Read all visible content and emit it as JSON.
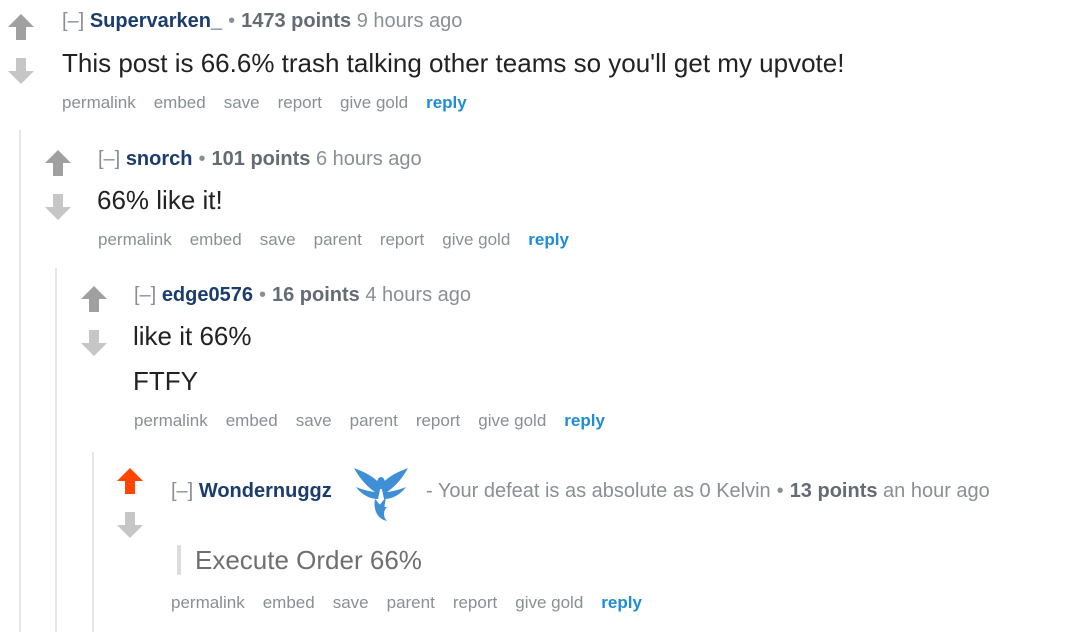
{
  "comments": [
    {
      "toggle": "[–]",
      "author": "Supervarken_",
      "score": "1473 points",
      "time": "9 hours ago",
      "body": [
        "This post is 66.6% trash talking other teams so you'll get my upvote!"
      ],
      "buttons": [
        "permalink",
        "embed",
        "save",
        "report",
        "give gold",
        "reply"
      ],
      "upvoted": false
    },
    {
      "toggle": "[–]",
      "author": "snorch",
      "score": "101 points",
      "time": "6 hours ago",
      "body": [
        "66% like it!"
      ],
      "buttons": [
        "permalink",
        "embed",
        "save",
        "parent",
        "report",
        "give gold",
        "reply"
      ],
      "upvoted": false
    },
    {
      "toggle": "[–]",
      "author": "edge0576",
      "score": "16 points",
      "time": "4 hours ago",
      "body": [
        "like it 66%",
        "FTFY"
      ],
      "buttons": [
        "permalink",
        "embed",
        "save",
        "parent",
        "report",
        "give gold",
        "reply"
      ],
      "upvoted": false
    },
    {
      "toggle": "[–]",
      "author": "Wondernuggz",
      "flair_text": "- Your defeat is as absolute as 0 Kelvin",
      "flair_icon": "team-mystic-bird-icon",
      "score": "13 points",
      "time": "an hour ago",
      "quote": "Execute Order 66%",
      "buttons": [
        "permalink",
        "embed",
        "save",
        "parent",
        "report",
        "give gold",
        "reply"
      ],
      "upvoted": true
    }
  ],
  "colors": {
    "upvote_active": "#ff4500",
    "upvote": "#a0a0a0",
    "downvote": "#c6c6c6",
    "author": "#1a3d6d",
    "reply": "#1f8cd6",
    "flair": "#3f8fd6"
  }
}
